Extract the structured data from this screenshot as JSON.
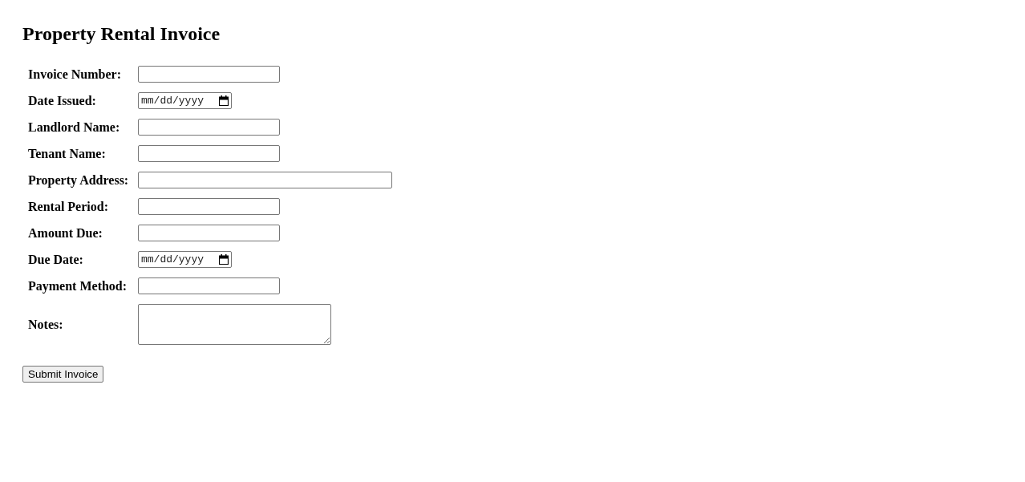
{
  "title": "Property Rental Invoice",
  "fields": [
    {
      "label": "Invoice Number:",
      "kind": "text"
    },
    {
      "label": "Date Issued:",
      "kind": "date",
      "placeholder": "mm/dd/yyyy"
    },
    {
      "label": "Landlord Name:",
      "kind": "text"
    },
    {
      "label": "Tenant Name:",
      "kind": "text"
    },
    {
      "label": "Property Address:",
      "kind": "text-wide"
    },
    {
      "label": "Rental Period:",
      "kind": "text"
    },
    {
      "label": "Amount Due:",
      "kind": "text"
    },
    {
      "label": "Due Date:",
      "kind": "date",
      "placeholder": "mm/dd/yyyy"
    },
    {
      "label": "Payment Method:",
      "kind": "text"
    },
    {
      "label": "Notes:",
      "kind": "textarea"
    }
  ],
  "submit_button": "Submit Invoice"
}
